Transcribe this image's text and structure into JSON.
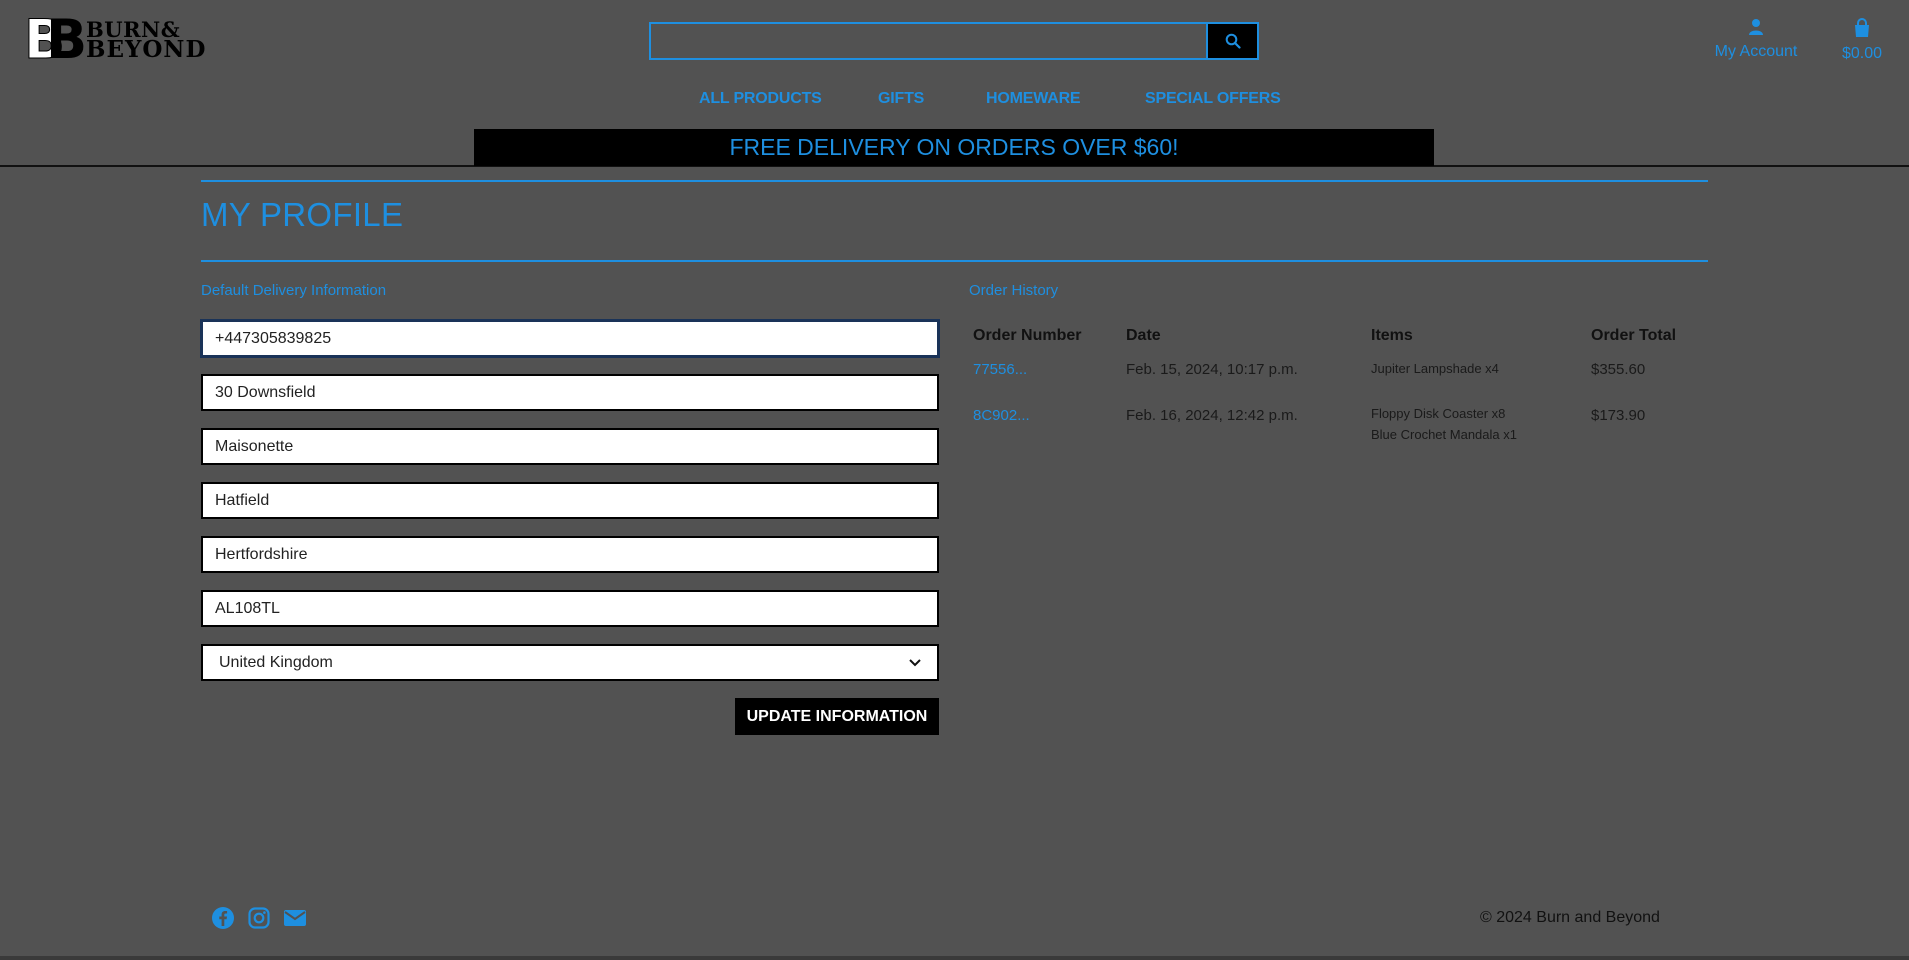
{
  "brand": {
    "line1": "BURN&",
    "line2": "BEYOND"
  },
  "search": {
    "placeholder": "",
    "value": ""
  },
  "header": {
    "account_label": "My Account",
    "cart_total": "$0.00"
  },
  "nav": [
    {
      "label": "ALL PRODUCTS"
    },
    {
      "label": "GIFTS"
    },
    {
      "label": "HOMEWARE"
    },
    {
      "label": "SPECIAL OFFERS"
    }
  ],
  "banner": "FREE DELIVERY ON ORDERS OVER $60!",
  "profile": {
    "title": "MY PROFILE",
    "delivery_heading": "Default Delivery Information",
    "phone": "+447305839825",
    "street1": "30 Downsfield",
    "street2": "Maisonette",
    "town": "Hatfield",
    "county": "Hertfordshire",
    "postcode": "AL108TL",
    "country": "United Kingdom",
    "update_label": "UPDATE INFORMATION"
  },
  "orders": {
    "heading": "Order History",
    "columns": [
      "Order Number",
      "Date",
      "Items",
      "Order Total"
    ],
    "rows": [
      {
        "number": "77556...",
        "date": "Feb. 15, 2024, 10:17 p.m.",
        "items": [
          "Jupiter Lampshade x4"
        ],
        "total": "$355.60"
      },
      {
        "number": "8C902...",
        "date": "Feb. 16, 2024, 12:42 p.m.",
        "items": [
          "Floppy Disk Coaster x8",
          "Blue Crochet Mandala x1"
        ],
        "total": "$173.90"
      }
    ]
  },
  "footer": {
    "icons": [
      "facebook-icon",
      "instagram-icon",
      "envelope-icon"
    ],
    "copyright": "© 2024 Burn and Beyond"
  },
  "colors": {
    "accent": "#1e8fe0",
    "background": "#525252",
    "banner_bg": "#000000"
  }
}
